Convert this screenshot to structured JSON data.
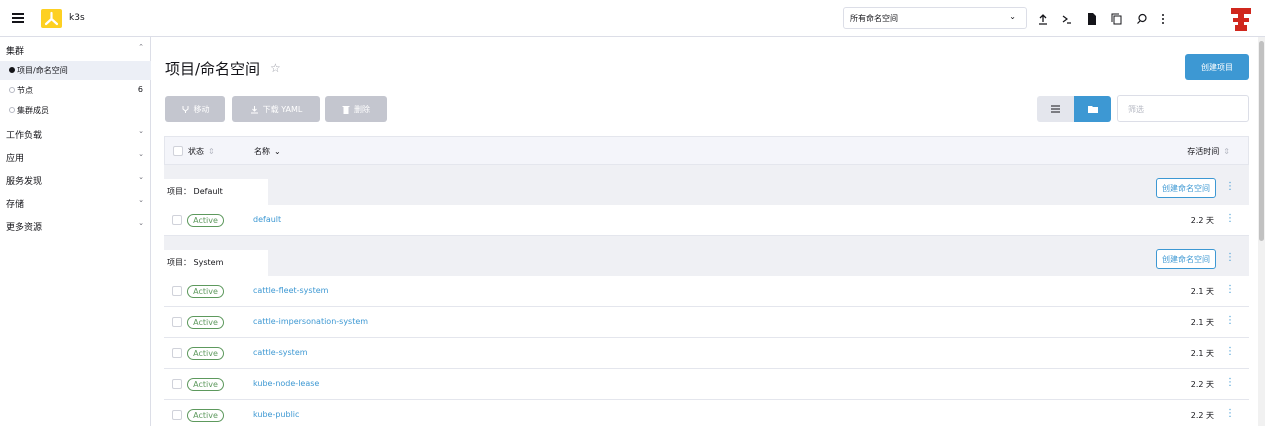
{
  "header": {
    "cluster_name": "k3s",
    "namespace_select": "所有命名空间"
  },
  "sidebar": {
    "groups": [
      {
        "label": "集群"
      },
      {
        "label": "工作负载"
      },
      {
        "label": "应用"
      },
      {
        "label": "服务发现"
      },
      {
        "label": "存储"
      },
      {
        "label": "更多资源"
      }
    ],
    "cluster_items": [
      {
        "label": "项目/命名空间",
        "count": ""
      },
      {
        "label": "节点",
        "count": "6"
      },
      {
        "label": "集群成员",
        "count": ""
      }
    ]
  },
  "main": {
    "title": "项目/命名空间",
    "create_label": "创建项目",
    "toolbar": {
      "move_label": "移动",
      "download_label": "下载 YAML",
      "delete_label": "删除"
    },
    "filter_placeholder": "筛选"
  },
  "table": {
    "columns": {
      "state": "状态",
      "name": "名称",
      "age": "存活时间"
    },
    "create_ns_label": "创建命名空间",
    "groups": [
      {
        "label": "项目： Default",
        "rows": [
          {
            "state": "Active",
            "name": "default",
            "age": "2.2 天"
          }
        ]
      },
      {
        "label": "项目： System",
        "rows": [
          {
            "state": "Active",
            "name": "cattle-fleet-system",
            "age": "2.1 天"
          },
          {
            "state": "Active",
            "name": "cattle-impersonation-system",
            "age": "2.1 天"
          },
          {
            "state": "Active",
            "name": "cattle-system",
            "age": "2.1 天"
          },
          {
            "state": "Active",
            "name": "kube-node-lease",
            "age": "2.2 天"
          },
          {
            "state": "Active",
            "name": "kube-public",
            "age": "2.2 天"
          }
        ]
      }
    ]
  },
  "colors": {
    "accent": "#3d98d3",
    "active": "#5d995d",
    "logo": "#fdd022"
  }
}
